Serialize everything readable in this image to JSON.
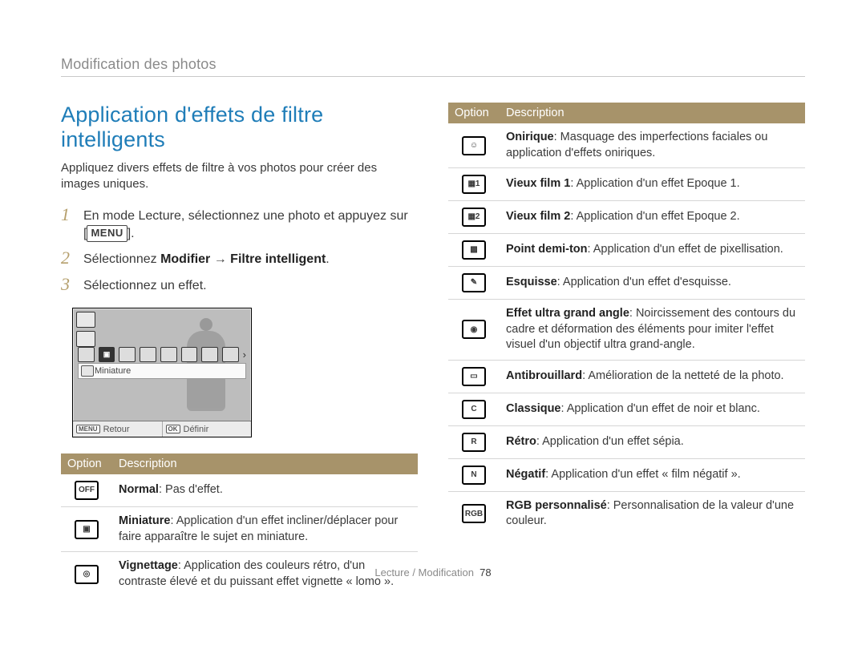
{
  "breadcrumb": "Modification des photos",
  "h2": "Application d'effets de filtre intelligents",
  "lead": "Appliquez divers effets de filtre à vos photos pour créer des images uniques.",
  "steps": {
    "s1a": "En mode Lecture, sélectionnez une photo et appuyez sur",
    "s1b": "[",
    "menu_chip": "MENU",
    "s1c": "].",
    "s2a": "Sélectionnez ",
    "s2b": "Modifier",
    "s2arrow": " → ",
    "s2c": "Filtre intelligent",
    "s2d": ".",
    "s3": "Sélectionnez un effet."
  },
  "lcd": {
    "row_label": "Miniature",
    "back_key": "MENU",
    "back_label": "Retour",
    "ok_key": "OK",
    "ok_label": "Définir",
    "arrow": "›"
  },
  "table_headers": {
    "opt": "Option",
    "desc": "Description"
  },
  "left_rows": [
    {
      "icon": "OFF",
      "b": "Normal",
      "t": ": Pas d'effet."
    },
    {
      "icon": "▣",
      "b": "Miniature",
      "t": ": Application d'un effet incliner/déplacer pour faire apparaître le sujet en miniature."
    },
    {
      "icon": "◎",
      "b": "Vignettage",
      "t": ": Application des couleurs rétro, d'un contraste élevé et du puissant effet vignette « lomo »."
    }
  ],
  "right_rows": [
    {
      "icon": "☺",
      "b": "Onirique",
      "t": ": Masquage des imperfections faciales ou application d'effets oniriques."
    },
    {
      "icon": "▦1",
      "b": "Vieux film 1",
      "t": ": Application d'un effet Epoque 1."
    },
    {
      "icon": "▦2",
      "b": "Vieux film 2",
      "t": ": Application d'un effet Epoque 2."
    },
    {
      "icon": "▩",
      "b": "Point demi-ton",
      "t": ": Application d'un effet de pixellisation."
    },
    {
      "icon": "✎",
      "b": "Esquisse",
      "t": ": Application d'un effet d'esquisse."
    },
    {
      "icon": "◉",
      "b": "Effet ultra grand angle",
      "t": ": Noircissement des contours du cadre et déformation des éléments pour imiter l'effet visuel d'un objectif ultra grand-angle."
    },
    {
      "icon": "▭",
      "b": "Antibrouillard",
      "t": ": Amélioration de la netteté de la photo."
    },
    {
      "icon": "C",
      "b": "Classique",
      "t": ": Application d'un effet de noir et blanc."
    },
    {
      "icon": "R",
      "b": "Rétro",
      "t": ": Application d'un effet sépia."
    },
    {
      "icon": "N",
      "b": "Négatif",
      "t": ": Application d'un effet « film négatif »."
    },
    {
      "icon": "RGB",
      "b": "RGB personnalisé",
      "t": ": Personnalisation de la valeur d'une couleur."
    }
  ],
  "footer": {
    "section": "Lecture / Modification",
    "page": "78"
  }
}
